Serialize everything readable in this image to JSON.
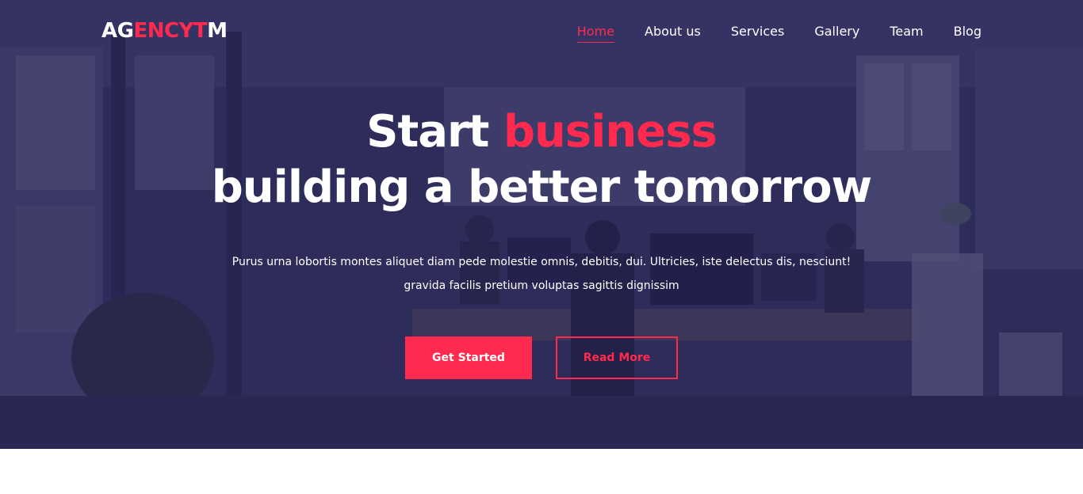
{
  "brand": {
    "logo_prefix": "AG",
    "logo_accent": "ENCYT",
    "logo_suffix": "M"
  },
  "nav": {
    "items": [
      {
        "label": "Home",
        "active": true
      },
      {
        "label": "About us"
      },
      {
        "label": "Services"
      },
      {
        "label": "Gallery"
      },
      {
        "label": "Team"
      },
      {
        "label": "Blog"
      }
    ]
  },
  "hero": {
    "headline_start": "Start",
    "headline_accent": "business",
    "headline_line2": "building a better tomorrow",
    "description": "Purus urna lobortis montes aliquet diam pede molestie omnis, debitis, dui. Ultricies, iste delectus dis, nesciunt! gravida facilis pretium voluptas sagittis dignissim",
    "primary_button": "Get Started",
    "secondary_button": "Read More"
  },
  "colors": {
    "accent": "#ff2a4d",
    "overlay": "#242252",
    "text": "#ffffff"
  }
}
